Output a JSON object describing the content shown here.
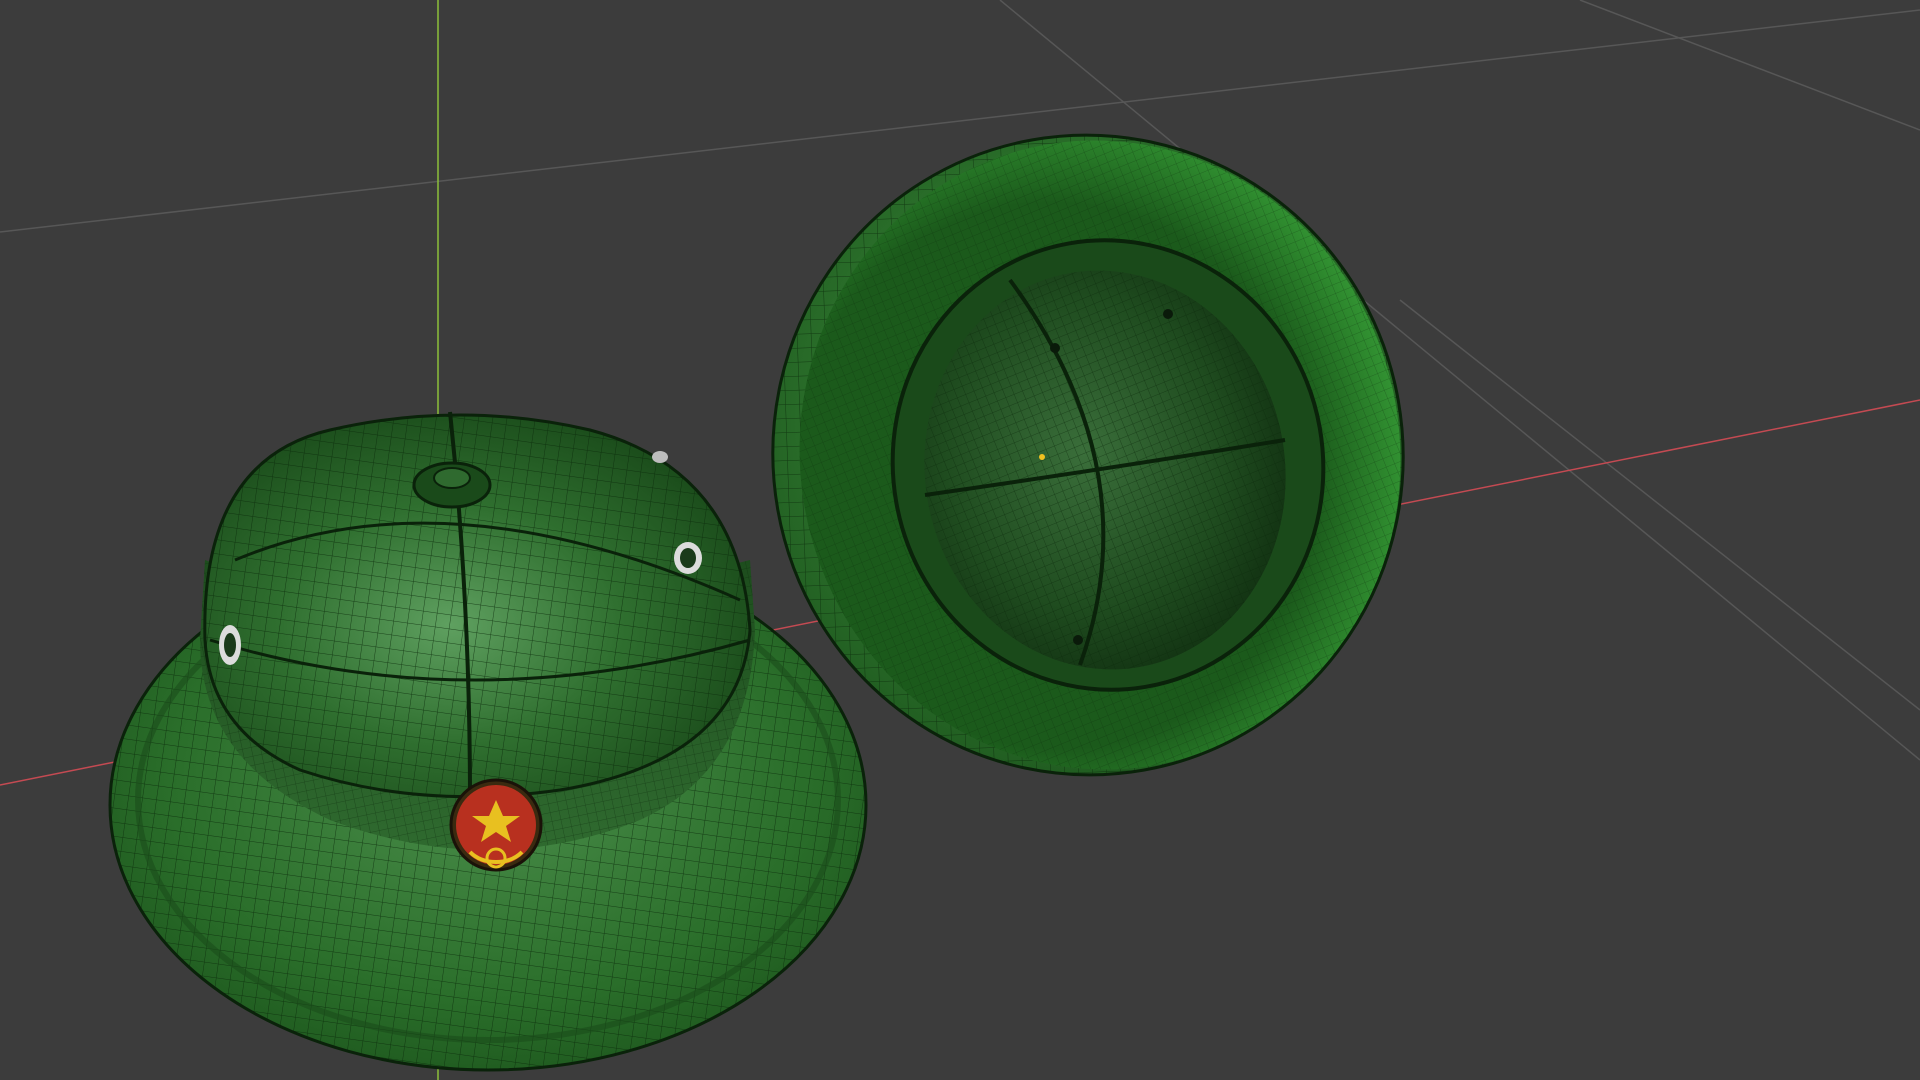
{
  "app": {
    "type": "3d-viewport",
    "view": "perspective"
  },
  "viewport": {
    "background_color": "#3c3c3c",
    "grid_color": "#5a5a5a",
    "x_axis_color": "#c44a52",
    "y_axis_color": "#8bbf3a"
  },
  "objects": [
    {
      "name": "hat-upright",
      "orientation": "crown-up",
      "material_color": "#2a7a2a",
      "wireframe": true,
      "emblem": {
        "shape": "star-with-cogwheel",
        "background_color": "#b8301f",
        "symbol_color": "#e8c020"
      },
      "vents": 3,
      "top_button": true
    },
    {
      "name": "hat-inverted",
      "orientation": "opening-facing-viewer",
      "material_color": "#2a7a2a",
      "wireframe": true,
      "origin_marker_color": "#f0c020"
    }
  ]
}
